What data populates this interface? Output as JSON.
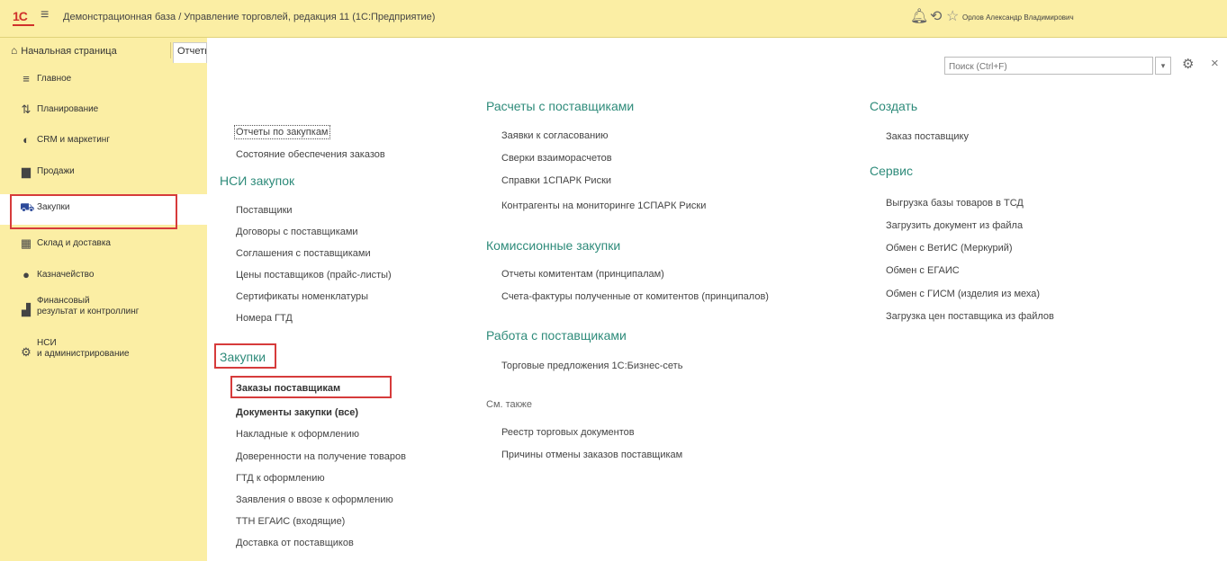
{
  "titlebar": {
    "logo": "1С",
    "app_title": "Демонстрационная база / Управление торговлей, редакция 11  (1С:Предприятие)",
    "user_name": "Орлов Александр Владимирович"
  },
  "tabs": {
    "home": "Начальная страница",
    "current": "Отчеты"
  },
  "sidebar": {
    "items": [
      {
        "label": "Главное",
        "icon": "menu-icon"
      },
      {
        "label": "Планирование",
        "icon": "chart-icon"
      },
      {
        "label": "CRM и маркетинг",
        "icon": "crm-icon"
      },
      {
        "label": "Продажи",
        "icon": "bag-icon"
      },
      {
        "label": "Закупки",
        "icon": "cart-icon"
      },
      {
        "label": "Склад и доставка",
        "icon": "warehouse-icon"
      },
      {
        "label": "Казначейство",
        "icon": "money-icon"
      },
      {
        "label": "Финансовый\nрезультат и контроллинг",
        "icon": "bar-chart-icon"
      },
      {
        "label": "НСИ\nи администрирование",
        "icon": "gear-icon"
      }
    ]
  },
  "search": {
    "placeholder": "Поиск (Ctrl+F)"
  },
  "col1": {
    "top_links": [
      "Отчеты по закупкам",
      "Состояние обеспечения заказов"
    ],
    "nsi_head": "НСИ закупок",
    "nsi_links": [
      "Поставщики",
      "Договоры с поставщиками",
      "Соглашения с поставщиками",
      "Цены поставщиков (прайс-листы)",
      "Сертификаты номенклатуры",
      "Номера ГТД"
    ],
    "purchases_head": "Закупки",
    "purchases_links": [
      "Заказы поставщикам",
      "Документы закупки (все)",
      "Накладные к оформлению",
      "Доверенности на получение товаров",
      "ГТД к оформлению",
      "Заявления о ввозе к оформлению",
      "ТТН ЕГАИС (входящие)",
      "Доставка от поставщиков"
    ]
  },
  "col2": {
    "settlements_head": "Расчеты с поставщиками",
    "settlements_links": [
      "Заявки к согласованию",
      "Сверки взаиморасчетов",
      "Справки 1СПАРК Риски",
      "Контрагенты на мониторинге 1СПАРК Риски"
    ],
    "commission_head": "Комиссионные закупки",
    "commission_links": [
      "Отчеты комитентам (принципалам)",
      "Счета-фактуры полученные от комитентов (принципалов)"
    ],
    "work_head": "Работа с поставщиками",
    "work_links": [
      "Торговые предложения 1С:Бизнес-сеть"
    ],
    "see_also": "См. также",
    "see_also_links": [
      "Реестр торговых документов",
      "Причины отмены заказов поставщикам"
    ]
  },
  "col3": {
    "create_head": "Создать",
    "create_links": [
      "Заказ поставщику"
    ],
    "service_head": "Сервис",
    "service_links": [
      "Выгрузка базы товаров в ТСД",
      "Загрузить документ из файла",
      "Обмен с ВетИС (Меркурий)",
      "Обмен с ЕГАИС",
      "Обмен с ГИСМ (изделия из меха)",
      "Загрузка цен поставщика из файлов"
    ]
  },
  "colors": {
    "titlebar": "#fbeea4",
    "accent": "#2e8b7a",
    "highlight": "#d63b3b"
  }
}
